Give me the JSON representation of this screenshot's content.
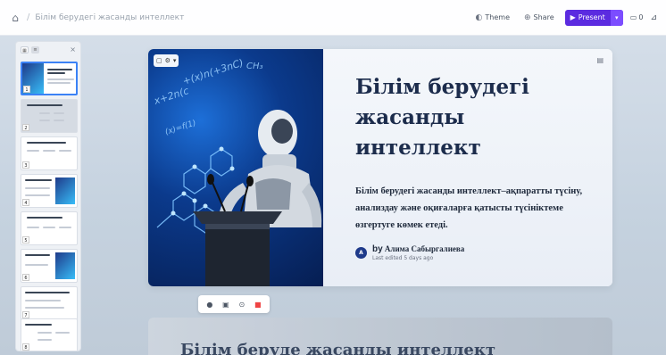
{
  "header": {
    "breadcrumb": "Білім берудегі жасанды интеллект",
    "theme_label": "Theme",
    "share_label": "Share",
    "present_label": "Present",
    "comments_count": "0"
  },
  "sidebar": {
    "thumbnails": [
      {
        "number": "1"
      },
      {
        "number": "2"
      },
      {
        "number": "3"
      },
      {
        "number": "4"
      },
      {
        "number": "5"
      },
      {
        "number": "6"
      },
      {
        "number": "7"
      },
      {
        "number": "8"
      }
    ]
  },
  "slide": {
    "title_line1": "Білім берудегі",
    "title_line2": "жасанды",
    "title_line3": "интеллект",
    "description": "Білім берудегі жасанды интеллект–ақпаратты түсіну, анализдау және оқиғаларға қатысты түсініктеме өзгертуге көмек етеді.",
    "author_prefix": "by",
    "author_name": "Алима Сабыргалиева",
    "author_initial": "A",
    "last_edited": "Last edited 5 days ago"
  },
  "slide2": {
    "title": "Білім беруде жасанды интеллект"
  },
  "colors": {
    "accent": "#5b2be0",
    "title": "#1c2c4c"
  }
}
